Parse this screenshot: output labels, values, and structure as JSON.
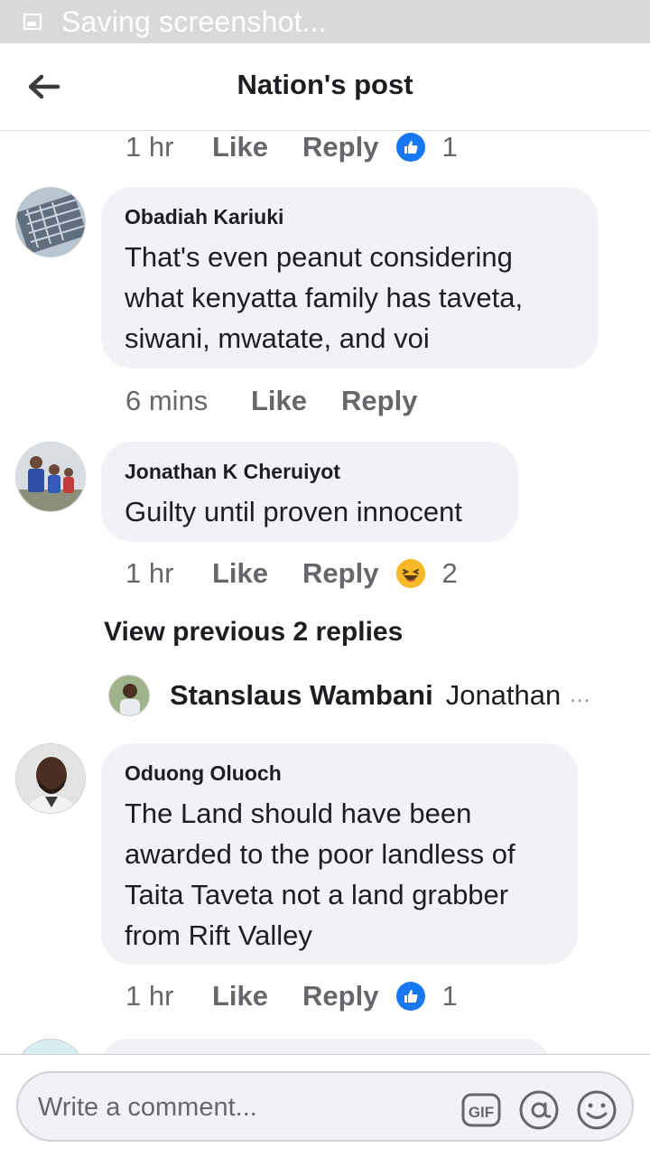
{
  "status_bar": {
    "text": "Saving screenshot..."
  },
  "header": {
    "title": "Nation's post"
  },
  "top_meta": {
    "time": "1 hr",
    "like": "Like",
    "reply": "Reply",
    "reaction_count": "1"
  },
  "comments": [
    {
      "author": "Obadiah Kariuki",
      "text": "That's even peanut  considering what kenyatta  family  has taveta, siwani, mwatate, and voi",
      "time": "6 mins",
      "like": "Like",
      "reply": "Reply"
    },
    {
      "author": "Jonathan K Cheruiyot",
      "text": "Guilty until proven innocent",
      "time": "1 hr",
      "like": "Like",
      "reply": "Reply",
      "reaction_count": "2"
    },
    {
      "author": "Oduong Oluoch",
      "text": "The Land should have been awarded to the poor landless of Taita Taveta not a land grabber from Rift Valley",
      "time": "1 hr",
      "like": "Like",
      "reply": "Reply",
      "reaction_count": "1"
    }
  ],
  "view_previous": "View previous 2 replies",
  "reply_preview": {
    "author": "Stanslaus Wambani",
    "text": "Jonathan",
    "more": "..."
  },
  "composer": {
    "placeholder": "Write a comment...",
    "gif_label": "GIF"
  },
  "colors": {
    "like_blue": "#1877f2",
    "bubble_bg": "#f0f2f5",
    "meta_gray": "#65676b",
    "haha_yellow": "#f7b928"
  },
  "icons": [
    "back-arrow-icon",
    "like-reaction-icon",
    "haha-reaction-icon",
    "gif-icon",
    "mention-icon",
    "emoji-icon"
  ]
}
